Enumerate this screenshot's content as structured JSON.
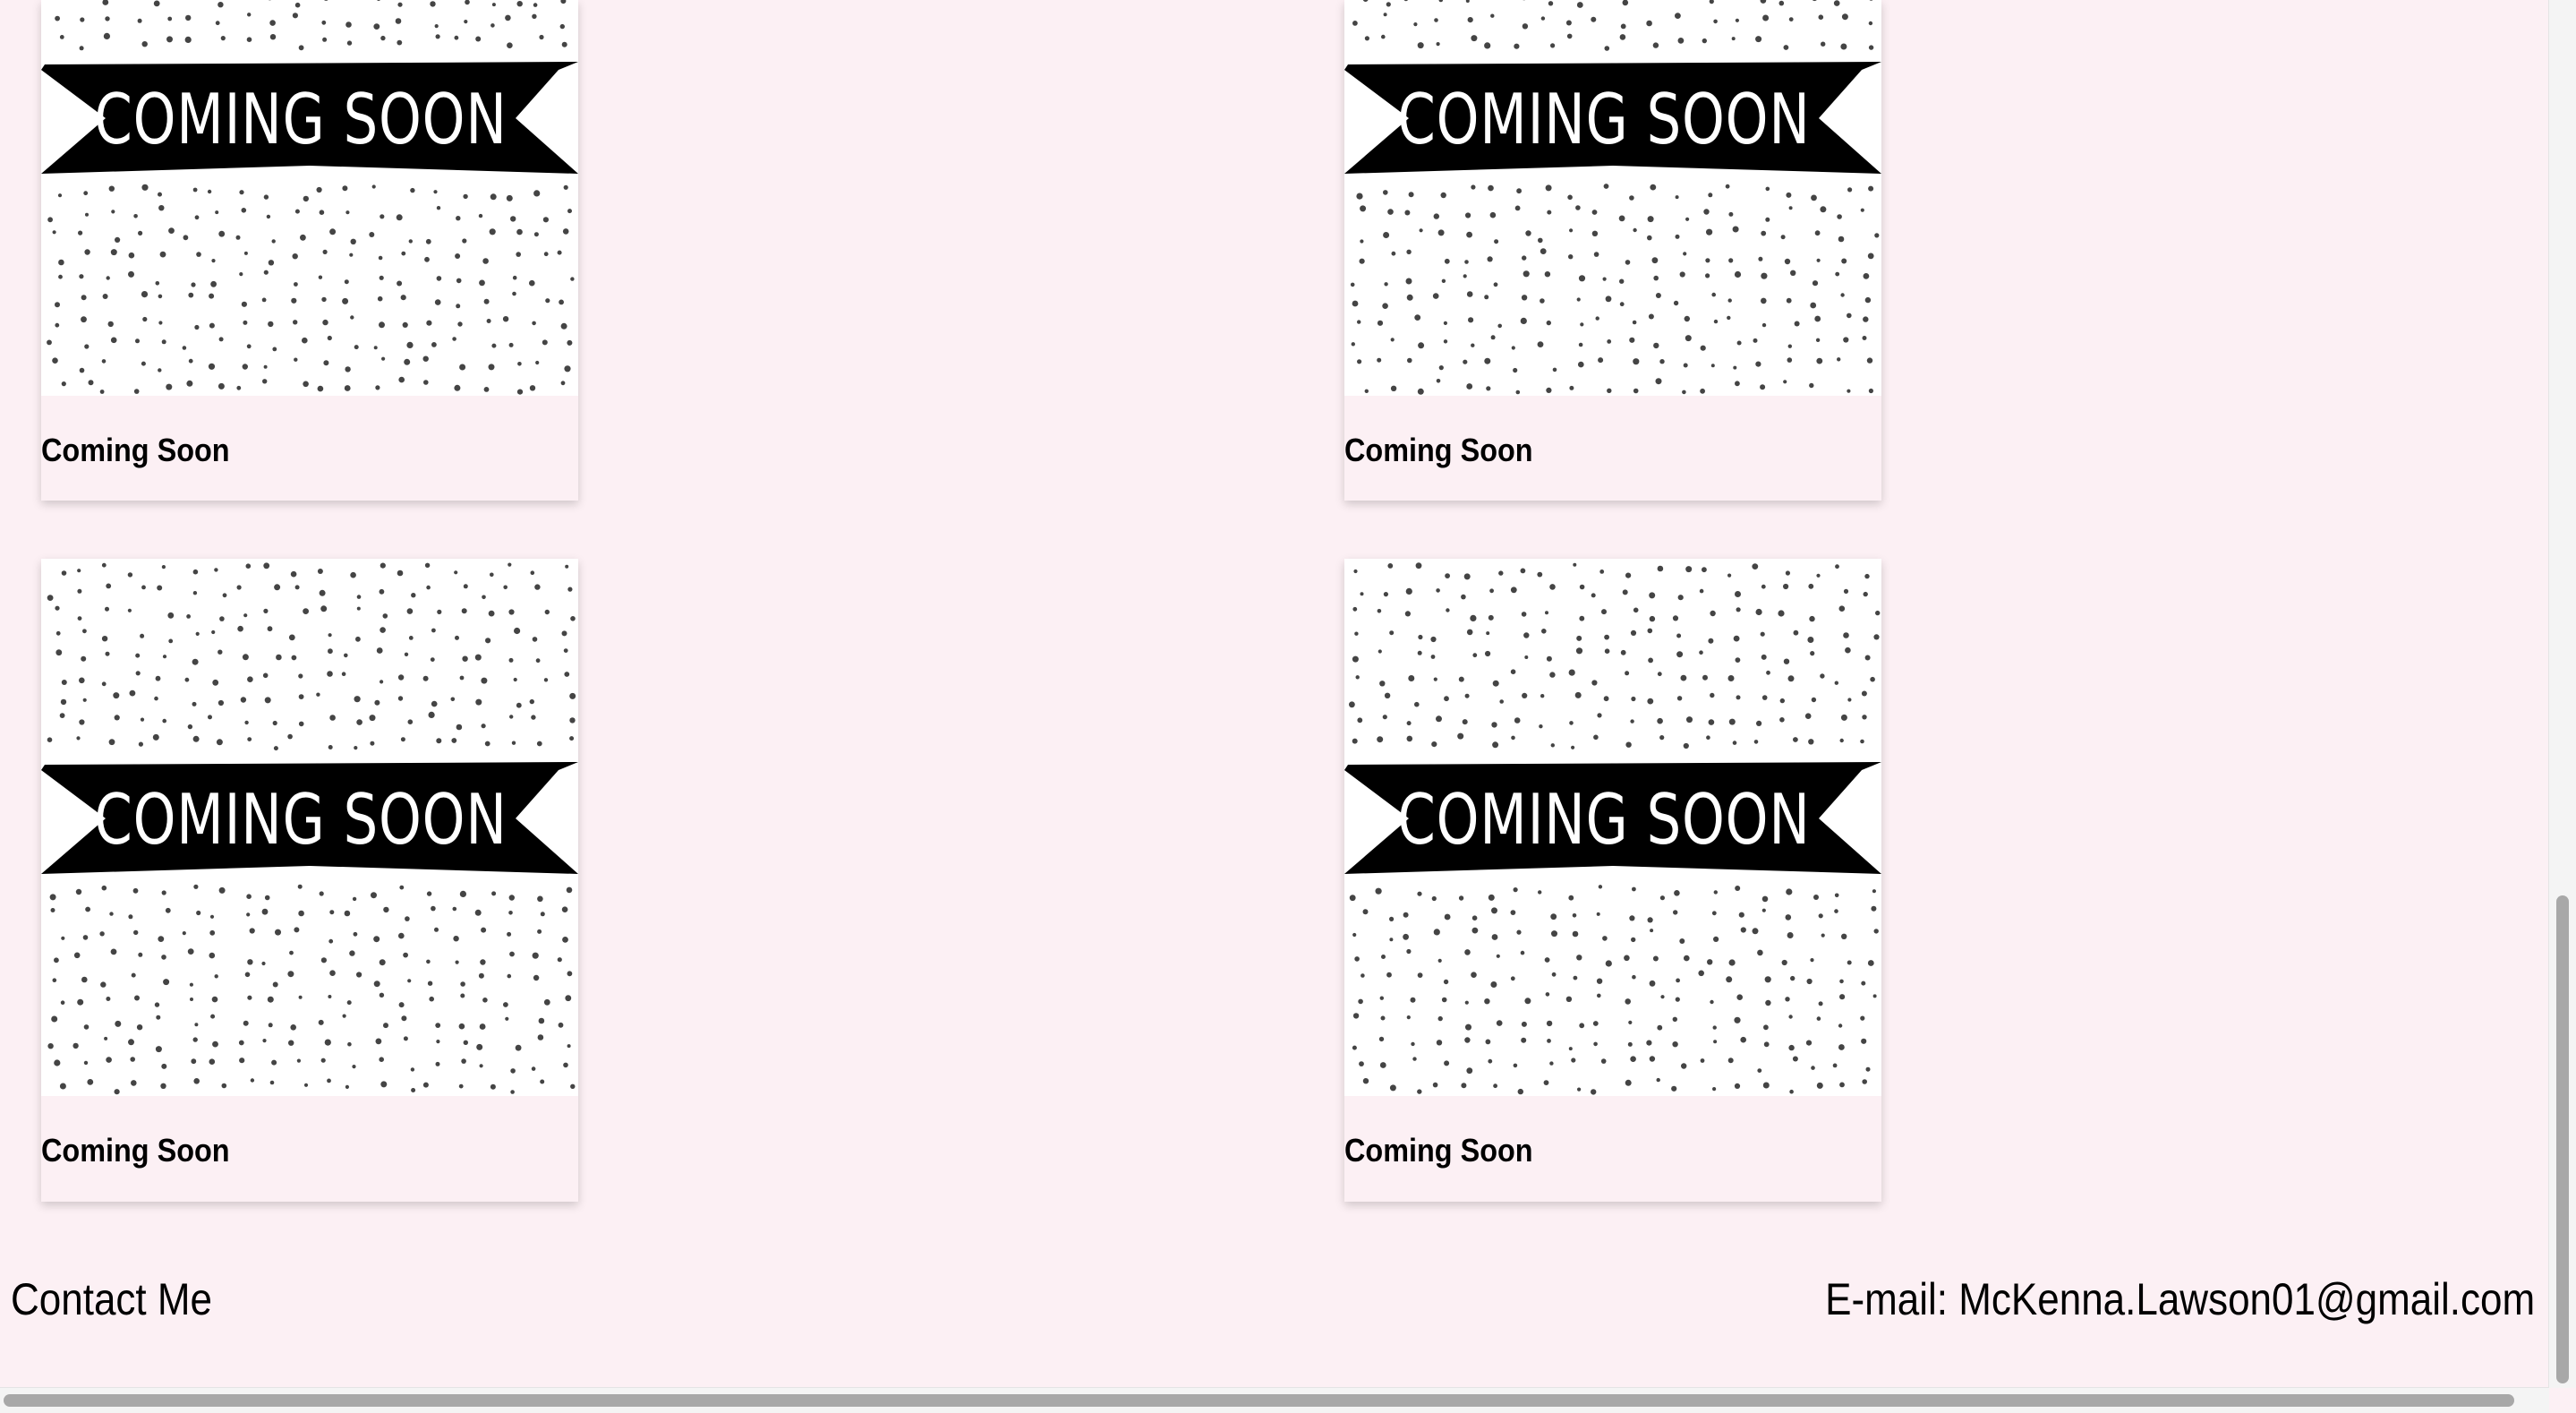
{
  "cards": [
    {
      "title": "Coming Soon",
      "image_text": "COMING SOON"
    },
    {
      "title": "Coming Soon",
      "image_text": "COMING SOON"
    },
    {
      "title": "Coming Soon",
      "image_text": "COMING SOON"
    },
    {
      "title": "Coming Soon",
      "image_text": "COMING SOON"
    }
  ],
  "footer": {
    "heading": "Contact Me",
    "email": "E-mail: McKenna.Lawson01@gmail.com"
  },
  "colors": {
    "page_background": "#fcf0f4",
    "banner": "#000000",
    "dots": "#444444"
  }
}
